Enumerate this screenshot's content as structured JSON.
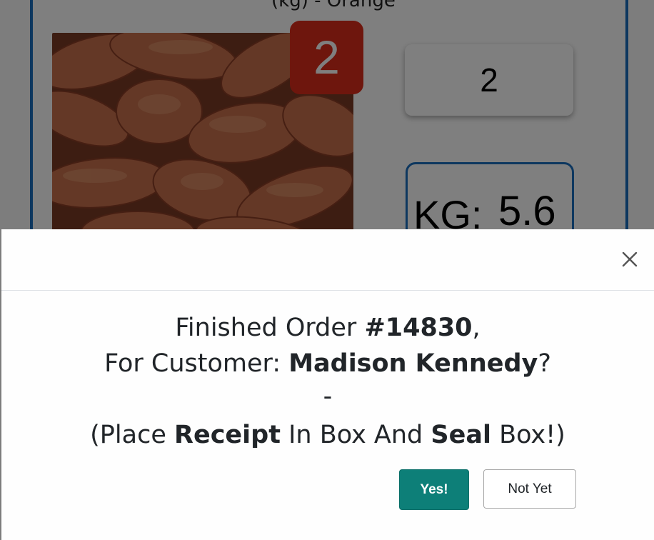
{
  "background": {
    "product_title_fragment": "(kg) - Orange",
    "image_label": "sweet potatoes",
    "badge_count": "2",
    "quantity_value": "2",
    "weight_label": "KG:",
    "weight_value": "5.6"
  },
  "modal": {
    "line1_prefix": "Finished Order ",
    "order_number": "#14830",
    "line1_suffix": ",",
    "line2_prefix": "For Customer: ",
    "customer_name": "Madison Kennedy",
    "line2_suffix": "?",
    "separator": "-",
    "line4_prefix": "(Place ",
    "line4_bold1": "Receipt",
    "line4_mid": " In Box And ",
    "line4_bold2": "Seal",
    "line4_suffix": " Box!)",
    "yes_label": "Yes!",
    "no_label": "Not Yet"
  },
  "colors": {
    "accent_blue": "#1a6fbf",
    "badge_red": "#dd2d1a",
    "confirm_teal": "#0d7f78",
    "overlay": "rgba(0,0,0,0.5)"
  },
  "icons": {
    "close": "close-icon"
  }
}
